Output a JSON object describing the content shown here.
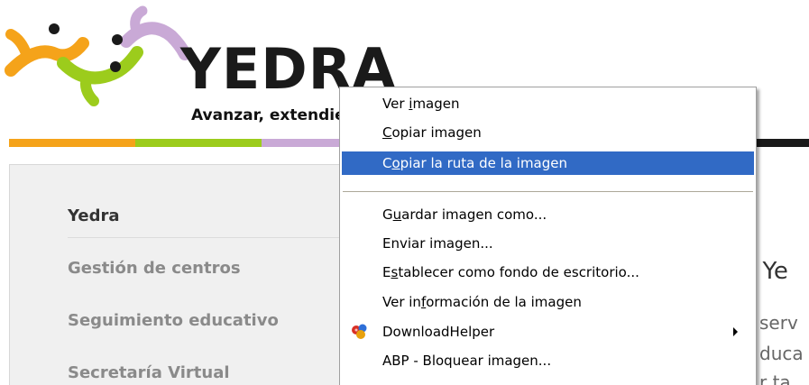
{
  "logo": {
    "wordmark": "YEDRA",
    "tagline": "Avanzar, extendiendo"
  },
  "side_menu": {
    "items": [
      {
        "label": "Yedra"
      },
      {
        "label": "Gestión de centros"
      },
      {
        "label": "Seguimiento educativo"
      },
      {
        "label": "Secretaría Virtual"
      }
    ]
  },
  "page": {
    "heading_fragment": "l Ye",
    "text_fragments": [
      "serv",
      "duca",
      "r ta"
    ]
  },
  "context_menu": {
    "items": [
      {
        "pre": "Ver ",
        "u": "i",
        "post": "magen"
      },
      {
        "pre": "",
        "u": "C",
        "post": "opiar imagen"
      },
      {
        "pre": "C",
        "u": "o",
        "post": "piar la ruta de la imagen",
        "selected": true
      },
      {
        "pre": "G",
        "u": "u",
        "post": "ardar imagen como..."
      },
      {
        "pre": "Enviar imagen...",
        "u": "",
        "post": ""
      },
      {
        "pre": "E",
        "u": "s",
        "post": "tablecer como fondo de escritorio..."
      },
      {
        "pre": "Ver in",
        "u": "f",
        "post": "ormación de la imagen"
      },
      {
        "pre": "DownloadHelper",
        "u": "",
        "post": "",
        "has_submenu": true,
        "icon": "downloadhelper-icon"
      },
      {
        "pre": "ABP - Bloquear imagen...",
        "u": "",
        "post": ""
      }
    ],
    "colors": {
      "highlight": "#316ac5",
      "highlight_text": "#ffffff"
    }
  },
  "colors": {
    "orange": "#f5a31a",
    "green": "#9ccc1c",
    "purple": "#c9a9d6",
    "dark": "#1a1a1a"
  }
}
